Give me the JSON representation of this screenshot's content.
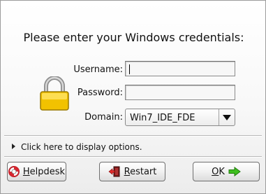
{
  "dialog": {
    "prompt": "Please enter your Windows credentials:",
    "username_label": "Username:",
    "username_value": "",
    "password_label": "Password:",
    "password_value": "",
    "domain_label": "Domain:",
    "domain_selected": "Win7_IDE_FDE",
    "options_link": "Click here to display options."
  },
  "buttons": {
    "helpdesk": {
      "first": "H",
      "rest": "elpdesk",
      "icon": "lifebuoy-icon"
    },
    "restart": {
      "first": "R",
      "rest": "estart",
      "icon": "restart-icon"
    },
    "ok": {
      "first": "O",
      "rest": "K",
      "icon": "arrow-right-icon"
    }
  },
  "colors": {
    "lock_gold": "#f2c200",
    "ok_arrow_green": "#3fbf1f",
    "restart_red": "#c0202a"
  }
}
